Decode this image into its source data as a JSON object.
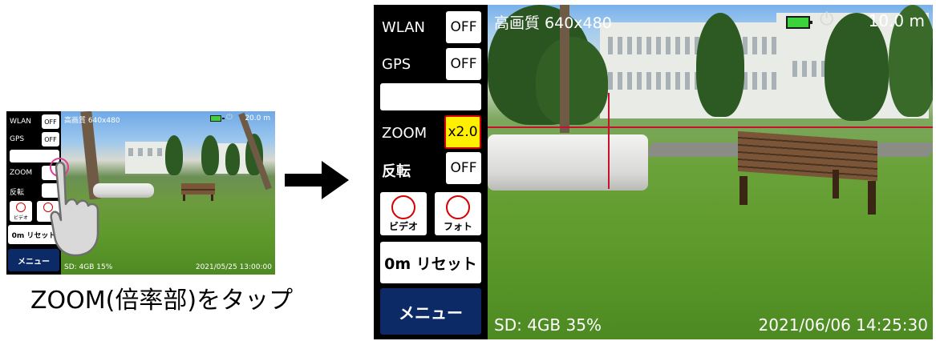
{
  "small": {
    "wlan_label": "WLAN",
    "wlan_value": "OFF",
    "gps_label": "GPS",
    "gps_value": "OFF",
    "zoom_label": "ZOOM",
    "invert_label": "反転",
    "video_label": "ビデオ",
    "reset_label": "0m リセット",
    "menu_label": "メニュー",
    "quality": "高画質 640x480",
    "distance": "20.0 m",
    "storage": "SD: 4GB  15%",
    "datetime": "2021/05/25 13:00:00"
  },
  "caption": "ZOOM(倍率部)をタップ",
  "large": {
    "wlan_label": "WLAN",
    "wlan_value": "OFF",
    "gps_label": "GPS",
    "gps_value": "OFF",
    "zoom_label": "ZOOM",
    "zoom_value": "x2.0",
    "invert_label": "反転",
    "invert_value": "OFF",
    "video_label": "ビデオ",
    "photo_label": "フォト",
    "reset_label": "0m リセット",
    "menu_label": "メニュー",
    "quality": "高画質  640x480",
    "distance": "10.0 m",
    "storage": "SD: 4GB  35%",
    "datetime": "2021/06/06  14:25:30"
  },
  "icons": [
    "battery-icon",
    "plug-icon",
    "hand-tap-icon",
    "arrow-right-icon",
    "record-circle-icon"
  ],
  "colors": {
    "panel_bg": "#000000",
    "menu_bg": "#0b2a66",
    "zoom_highlight": "#ffef00",
    "record_red": "#d60000",
    "battery_green": "#3cd23c"
  }
}
